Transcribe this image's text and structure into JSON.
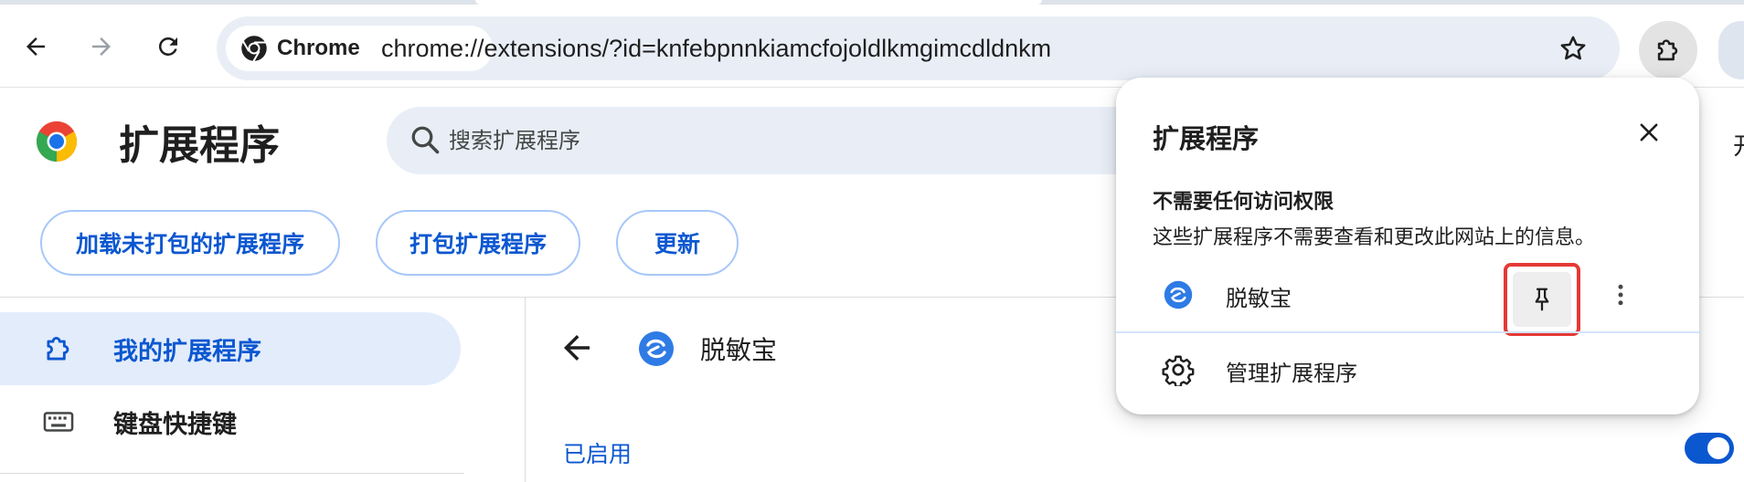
{
  "browser": {
    "chip_label": "Chrome",
    "url": "chrome://extensions/?id=knfebpnnkiamcfojoldlkmgimcdldnkm"
  },
  "page": {
    "title": "扩展程序",
    "search_placeholder": "搜索扩展程序",
    "actions": {
      "load_unpacked": "加载未打包的扩展程序",
      "pack": "打包扩展程序",
      "update": "更新"
    },
    "sidebar": {
      "items": [
        {
          "label": "我的扩展程序",
          "icon": "puzzle-icon",
          "active": true
        },
        {
          "label": "键盘快捷键",
          "icon": "keyboard-icon",
          "active": false
        }
      ]
    },
    "detail": {
      "name": "脱敏宝",
      "status_label": "已启用",
      "enabled": true
    },
    "edge_glyph": "开"
  },
  "popup": {
    "title": "扩展程序",
    "section_heading": "不需要任何访问权限",
    "section_description": "这些扩展程序不需要查看和更改此网站上的信息。",
    "extension_name": "脱敏宝",
    "manage_label": "管理扩展程序"
  },
  "colors": {
    "accent": "#0b57d0",
    "highlight_border": "#e53935",
    "omnibox_bg": "#e9eef6",
    "active_nav_bg": "#e3ecfb"
  }
}
